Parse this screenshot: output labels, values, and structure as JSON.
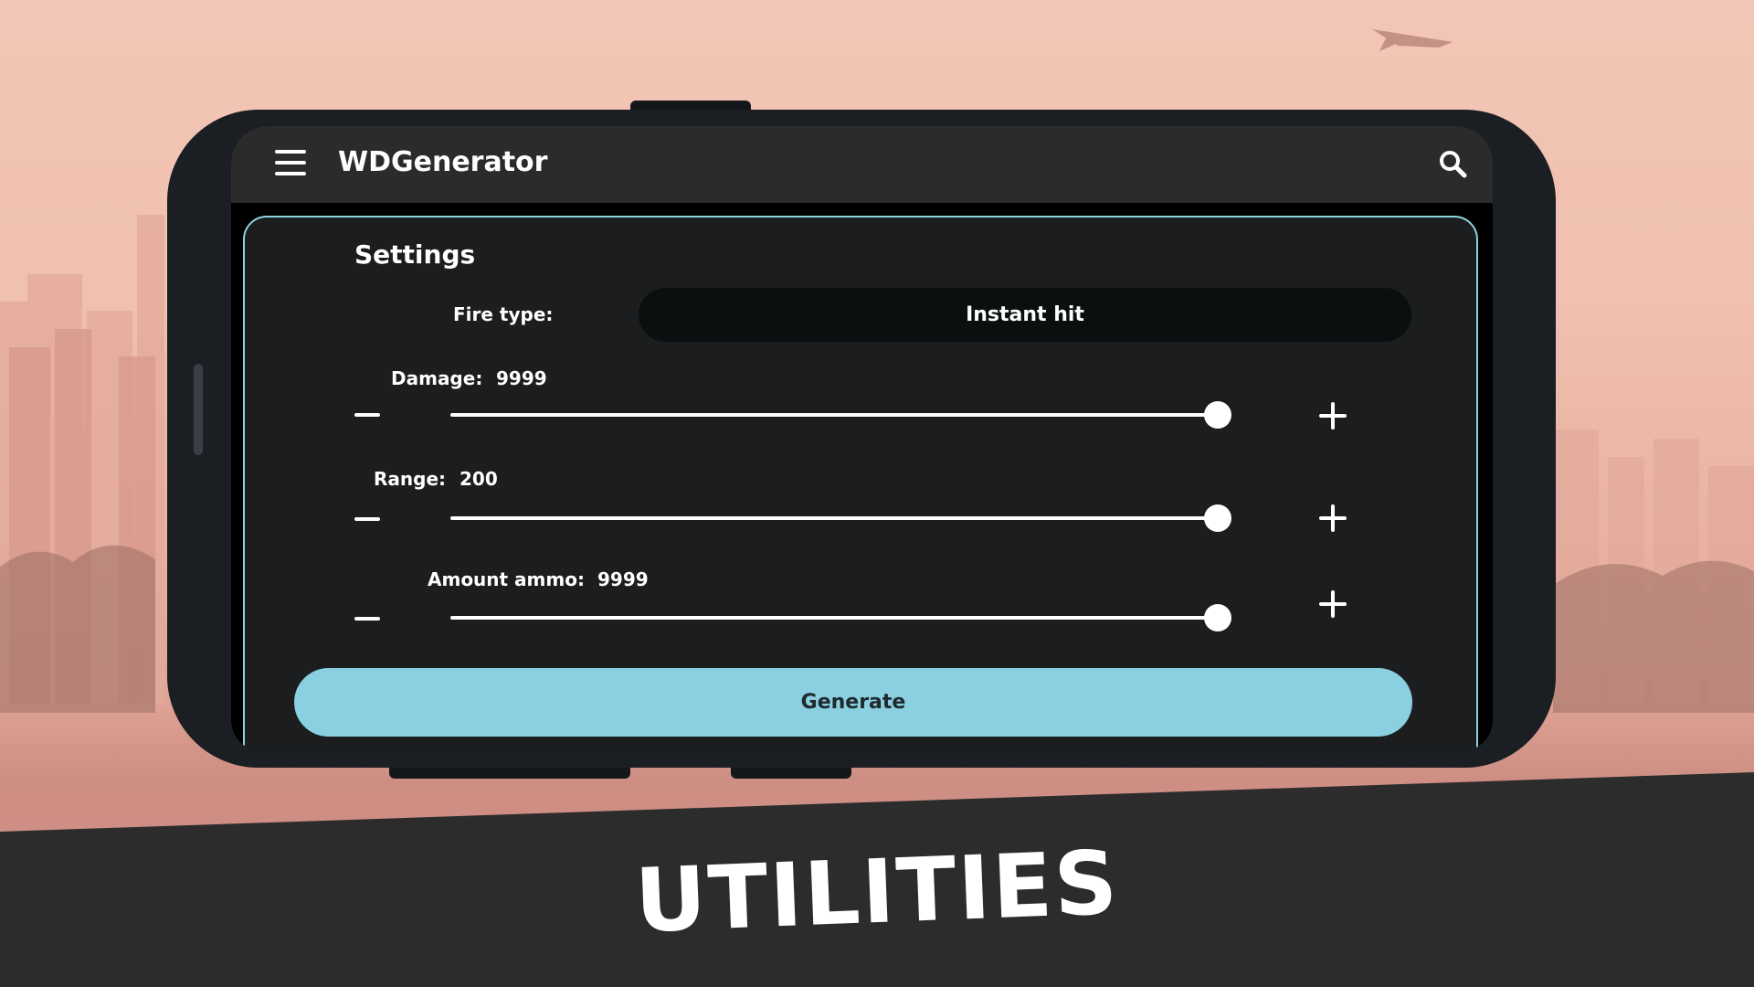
{
  "app": {
    "title": "WDGenerator"
  },
  "settings": {
    "title": "Settings",
    "fire_type": {
      "label": "Fire type:",
      "value": "Instant hit"
    },
    "damage": {
      "label": "Damage:",
      "value": "9999",
      "fraction": 1.0
    },
    "range": {
      "label": "Range:",
      "value": "200",
      "fraction": 1.0
    },
    "ammo": {
      "label": "Amount ammo:",
      "value": "9999",
      "fraction": 1.0
    }
  },
  "generate_label": "Generate",
  "banner": {
    "text": "UTILITIES"
  },
  "colors": {
    "accent": "#8ad0e0",
    "appbar": "#2b2b2b",
    "card": "#1c1d1f",
    "banner": "#2c2c2c"
  },
  "icons": {
    "menu": "hamburger-icon",
    "search": "search-icon",
    "minus": "minus-icon",
    "plus": "plus-icon"
  }
}
